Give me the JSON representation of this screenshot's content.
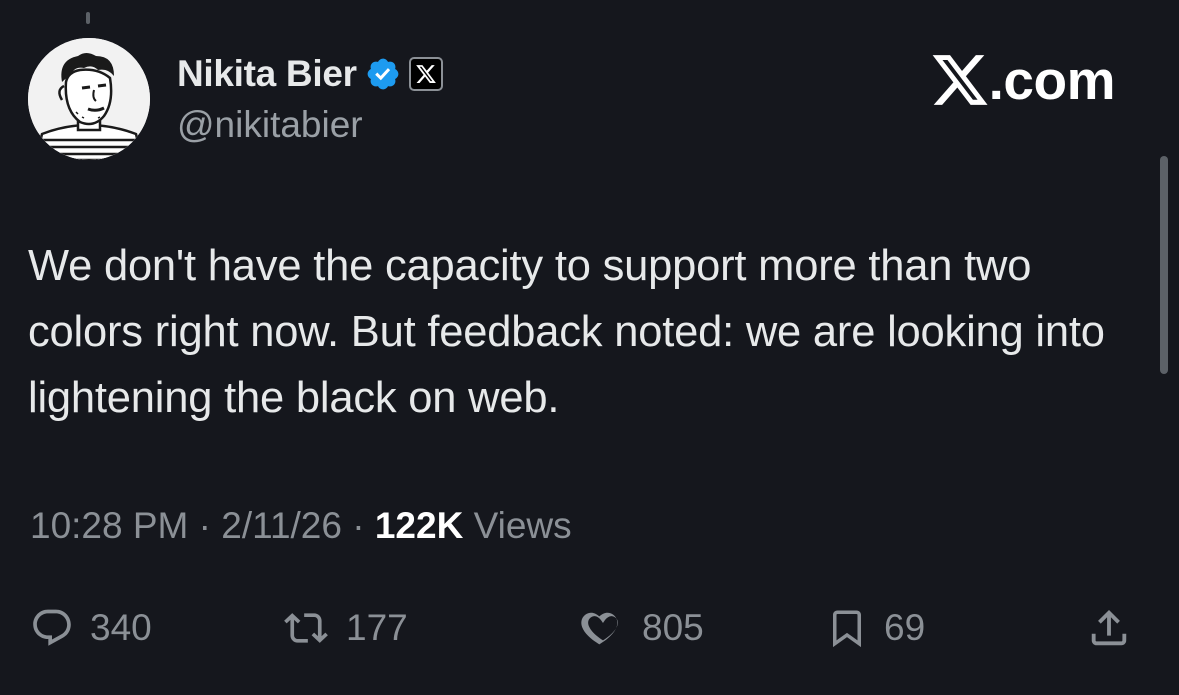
{
  "colors": {
    "background": "#15171d",
    "text_primary": "#e7e9ea",
    "text_secondary": "#8b9096",
    "verified_blue": "#1d9bf0"
  },
  "header": {
    "display_name": "Nikita Bier",
    "handle": "@nikitabier",
    "verified_icon": "verified-badge-icon",
    "affiliate_icon": "x-logo-icon",
    "avatar_icon": "avatar-sketch"
  },
  "watermark": {
    "logo_icon": "x-logo-icon",
    "text": ".com"
  },
  "tweet": {
    "text": "We don't have the capacity to support more than two colors right now. But feedback noted: we are looking into lightening the black on web."
  },
  "meta": {
    "time": "10:28 PM",
    "separator": " · ",
    "date": "2/11/26",
    "views_count": "122K",
    "views_label": " Views"
  },
  "actions": {
    "reply": {
      "icon": "reply-icon",
      "count": "340"
    },
    "retweet": {
      "icon": "retweet-icon",
      "count": "177"
    },
    "like": {
      "icon": "heart-icon",
      "count": "805"
    },
    "bookmark": {
      "icon": "bookmark-icon",
      "count": "69"
    },
    "share": {
      "icon": "share-icon"
    }
  }
}
